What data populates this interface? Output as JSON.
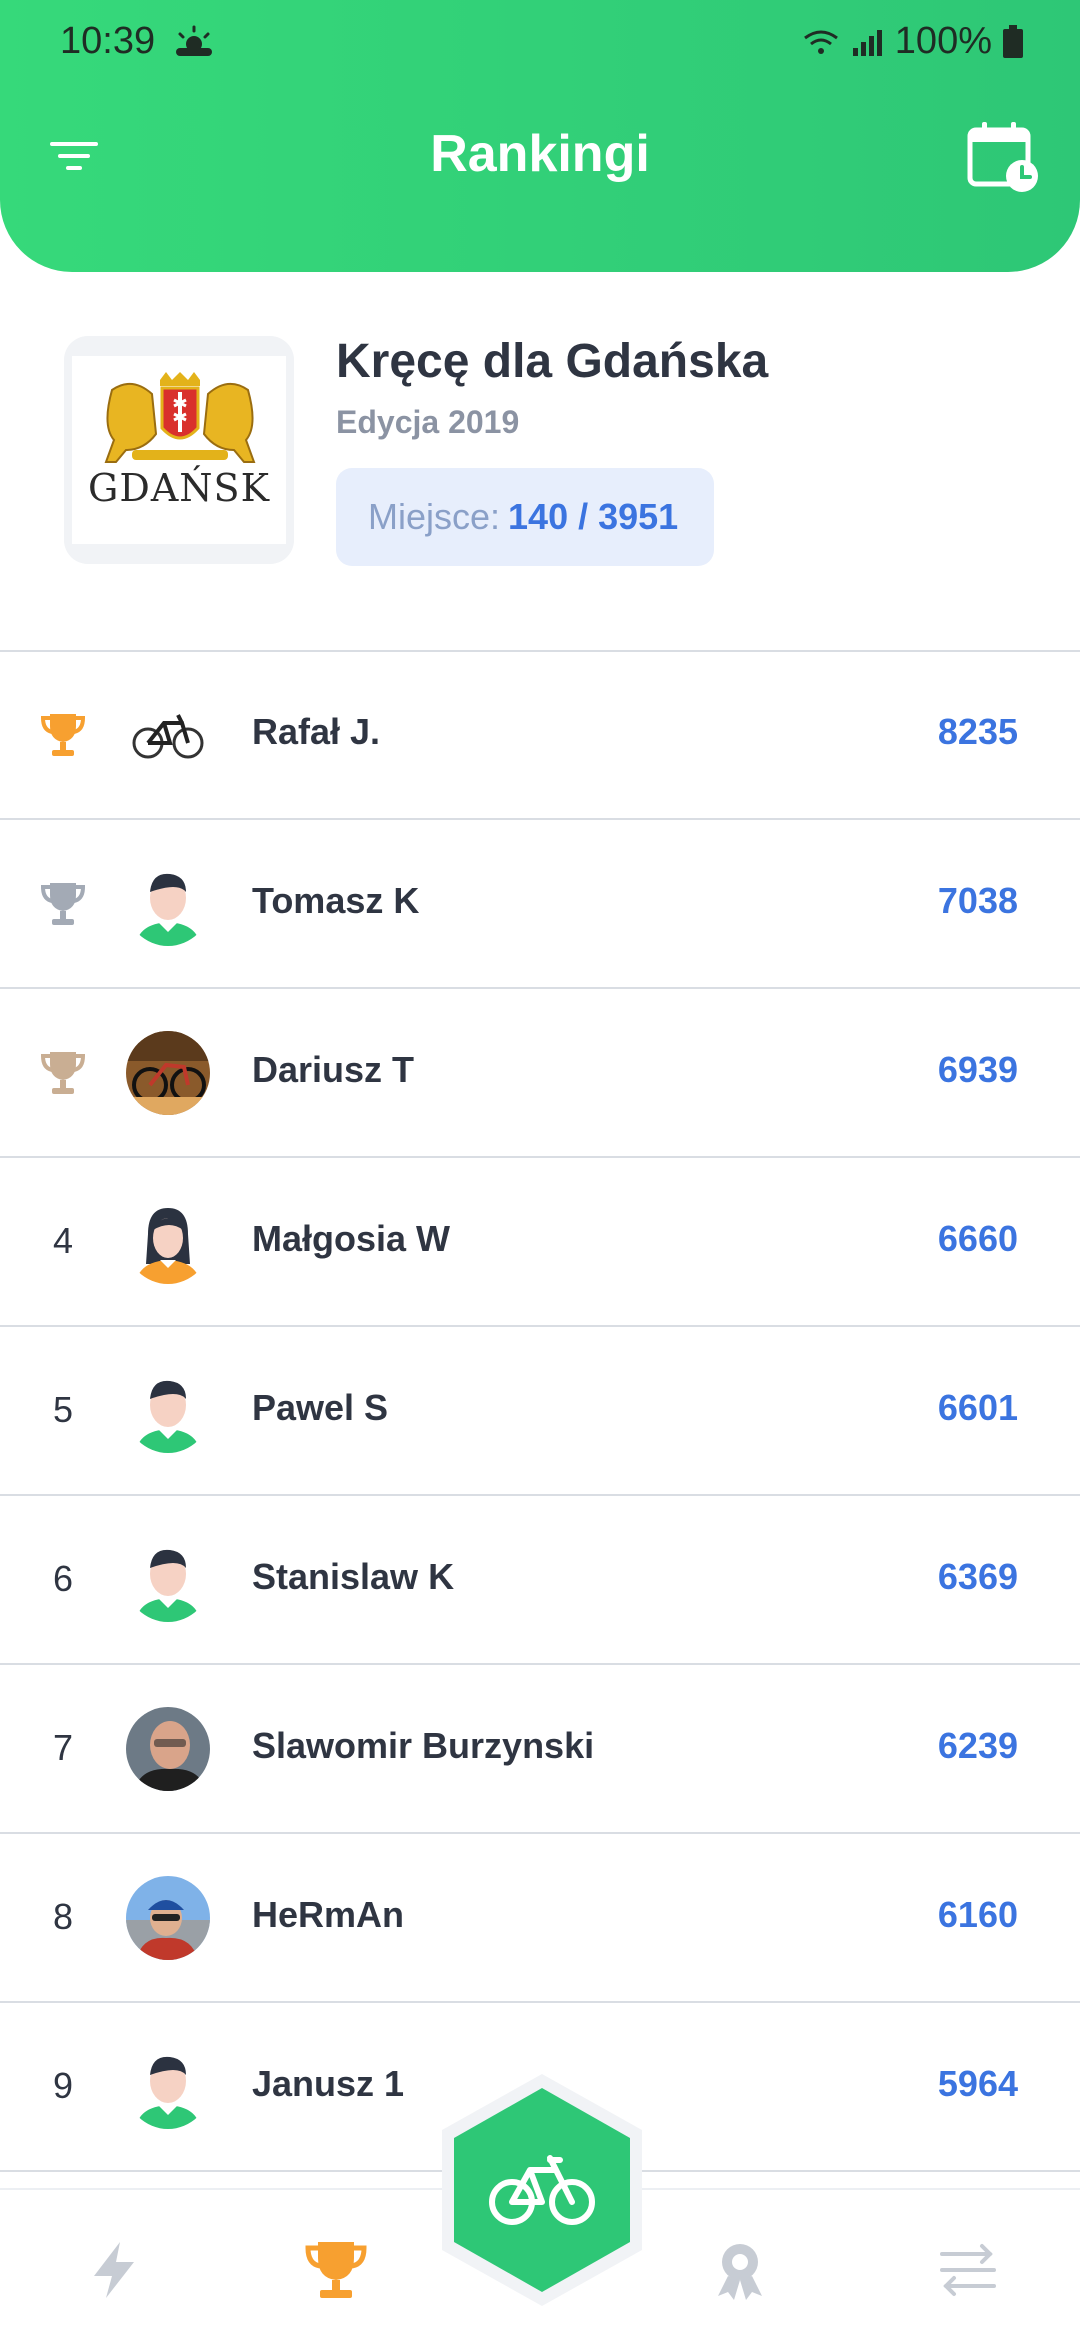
{
  "status_bar": {
    "time": "10:39",
    "battery": "100%"
  },
  "header": {
    "title": "Rankingi"
  },
  "event": {
    "logo_text": "GDAŃSK",
    "title": "Kręcę dla Gdańska",
    "edition": "Edycja 2019",
    "place_label": "Miejsce:",
    "place_value": "140 / 3951"
  },
  "rankings": [
    {
      "rank": "1",
      "trophy": "gold",
      "avatar": "bike-avatar",
      "name": "Rafał J.",
      "score": "8235"
    },
    {
      "rank": "2",
      "trophy": "silver",
      "avatar": "male-avatar",
      "name": "Tomasz K",
      "score": "7038"
    },
    {
      "rank": "3",
      "trophy": "bronze",
      "avatar": "photo-bike-avatar",
      "name": "Dariusz T",
      "score": "6939"
    },
    {
      "rank": "4",
      "trophy": "",
      "avatar": "female-avatar",
      "name": "Małgosia W",
      "score": "6660"
    },
    {
      "rank": "5",
      "trophy": "",
      "avatar": "male-avatar",
      "name": "Pawel S",
      "score": "6601"
    },
    {
      "rank": "6",
      "trophy": "",
      "avatar": "male-avatar",
      "name": "Stanislaw K",
      "score": "6369"
    },
    {
      "rank": "7",
      "trophy": "",
      "avatar": "photo-man-avatar",
      "name": "Slawomir Burzynski",
      "score": "6239"
    },
    {
      "rank": "8",
      "trophy": "",
      "avatar": "photo-cyclist-avatar",
      "name": "HeRmAn",
      "score": "6160"
    },
    {
      "rank": "9",
      "trophy": "",
      "avatar": "male-avatar",
      "name": "Janusz 1",
      "score": "5964"
    }
  ],
  "colors": {
    "accent_green": "#2ec776",
    "score_blue": "#3b74e0",
    "gold": "#f7a030",
    "silver": "#a3aab5",
    "bronze": "#c9ae93",
    "nav_inactive": "#c7ccd4"
  },
  "icons": {
    "filter": "filter-icon",
    "calendar": "calendar-clock-icon",
    "bolt": "lightning-icon",
    "trophy_nav": "trophy-icon",
    "bike": "bicycle-icon",
    "badge": "medal-badge-icon",
    "transfer": "transfer-arrows-icon"
  }
}
